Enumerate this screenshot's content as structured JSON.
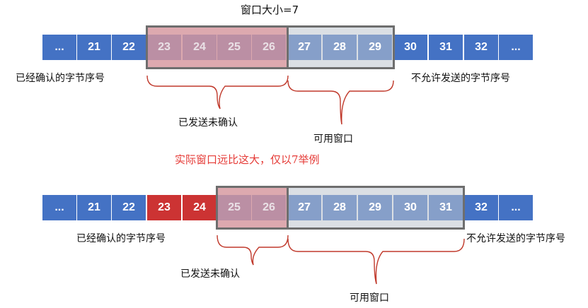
{
  "colors": {
    "blue": "#4472c4",
    "red": "#cc3333",
    "sent_overlay": "#d9a0a5",
    "available_overlay": "#a9b8cf",
    "window_border": "#6e6e6e",
    "bracket": "#c0392b",
    "note": "#e53935"
  },
  "top": {
    "window_title": "窗口大小=7",
    "cells": [
      "...",
      "21",
      "22",
      "23",
      "24",
      "25",
      "26",
      "27",
      "28",
      "29",
      "30",
      "31",
      "32",
      "..."
    ],
    "labels": {
      "acked": "已经确认的字节序号",
      "not_allowed": "不允许发送的字节序号",
      "sent_unacked": "已发送未确认",
      "available": "可用窗口"
    }
  },
  "note": "实际窗口远比这大，仅以7举例",
  "bottom": {
    "cells": [
      "...",
      "21",
      "22",
      "23",
      "24",
      "25",
      "26",
      "27",
      "28",
      "29",
      "30",
      "31",
      "32",
      "..."
    ],
    "labels": {
      "acked": "已经确认的字节序号",
      "not_allowed": "不允许发送的字节序号",
      "sent_unacked": "已发送未确认",
      "available": "可用窗口"
    }
  }
}
